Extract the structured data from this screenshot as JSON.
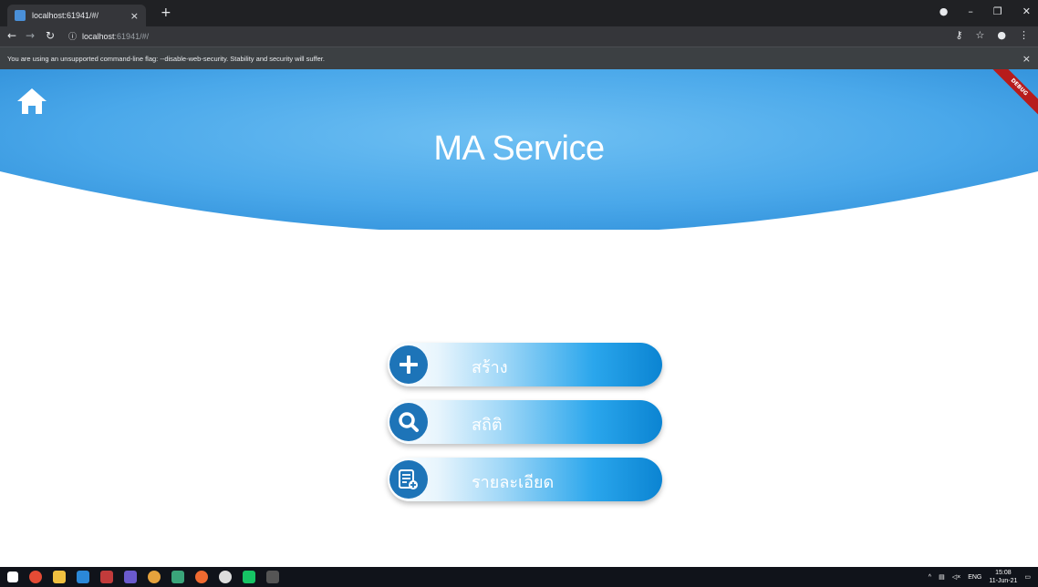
{
  "browser": {
    "tab_title": "localhost:61941/#/",
    "tab_close": "×",
    "new_tab": "+",
    "url_host": "localhost",
    "url_path": ":61941/#/",
    "warning": "You are using an unsupported command-line flag: --disable-web-security. Stability and security will suffer.",
    "warning_close": "×"
  },
  "app": {
    "title": "MA Service",
    "debug_label": "DEBUG",
    "buttons": [
      {
        "label": "สร้าง",
        "icon": "plus-icon"
      },
      {
        "label": "สถิติ",
        "icon": "search-icon"
      },
      {
        "label": "รายละเอียด",
        "icon": "list-detail-icon"
      }
    ],
    "colors": {
      "header": "#4aa8ea",
      "button_end": "#0b84d2",
      "icon_circle": "#1d74b8"
    }
  },
  "taskbar": {
    "lang": "ENG",
    "time": "15:08",
    "date": "11-Jun-21"
  }
}
